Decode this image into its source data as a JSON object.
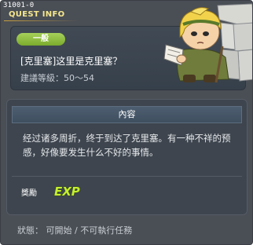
{
  "window": {
    "quest_id": "31001-0",
    "title": "QUEST INFO"
  },
  "quest": {
    "category": "一般",
    "title": "[克里塞]这里是克里塞？",
    "level": "建議等級：50～54"
  },
  "content": {
    "header": "內容",
    "description": "经过诸多周折，终于到达了克里塞。有一种不祥的预感，好像要发生什么不好的事情。",
    "reward_label": "獎勵",
    "reward_icon": "exp-icon",
    "reward_icon_text": "EXP"
  },
  "status": {
    "text": "狀態： 可開始 / 不可執行任務"
  },
  "colors": {
    "title": "#f6e78e",
    "badge": "#8cbf3a",
    "exp": "#c6ef2e",
    "background": "#4a4e55"
  },
  "npc": {
    "icon": "npc-portrait-icon"
  }
}
